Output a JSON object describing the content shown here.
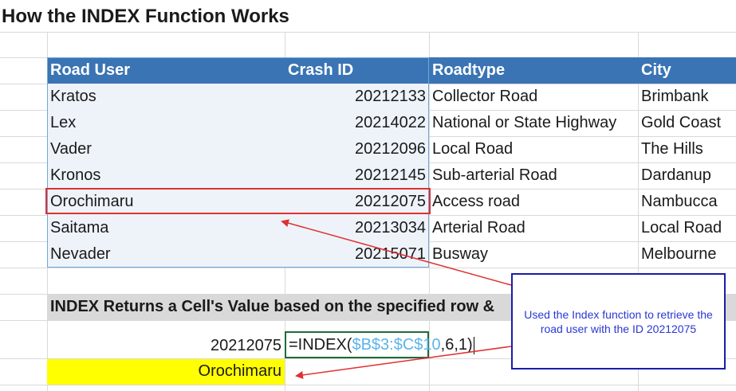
{
  "title": "How the INDEX Function Works",
  "table": {
    "headers": [
      "Road User",
      "Crash ID",
      "Roadtype",
      "City"
    ],
    "rows": [
      [
        "Kratos",
        "20212133",
        "Collector Road",
        "Brimbank"
      ],
      [
        "Lex",
        "20214022",
        "National or State Highway",
        "Gold Coast"
      ],
      [
        "Vader",
        "20212096",
        "Local Road",
        "The Hills"
      ],
      [
        "Kronos",
        "20212145",
        "Sub-arterial Road",
        "Dardanup"
      ],
      [
        "Orochimaru",
        "20212075",
        "Access road",
        "Nambucca"
      ],
      [
        "Saitama",
        "20213034",
        "Arterial Road",
        "Local Road"
      ],
      [
        "Nevader",
        "20215071",
        "Busway",
        "Melbourne"
      ]
    ]
  },
  "section_heading": "INDEX Returns a Cell's Value based on the specified row &",
  "lookup": {
    "input_value": "20212075",
    "formula_prefix": "=INDEX(",
    "formula_ref": "$B$3:$C$10",
    "formula_suffix": ",6,1)",
    "result": "Orochimaru"
  },
  "callout_text": "Used the Index function to retrieve the road user with the ID 20212075",
  "colors": {
    "header_fill": "#3a74b4",
    "selection_fill": "#eef3fa",
    "result_fill": "#ffff00",
    "heading_band": "#d9d9d9",
    "arrow": "#e03030"
  }
}
